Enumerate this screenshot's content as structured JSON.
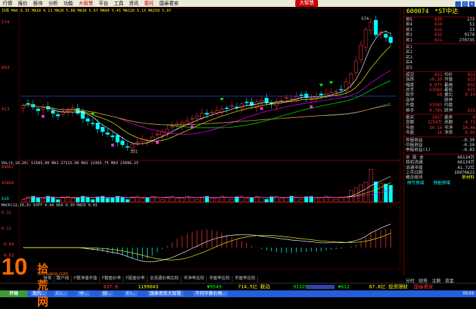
{
  "menu": {
    "items": [
      "行情",
      "报价",
      "板块",
      "分析",
      "功能",
      "大智慧",
      "平台",
      "工具",
      "资讯",
      "委托",
      "国泰君安"
    ],
    "brand": "大智慧"
  },
  "window_buttons": [
    "_",
    "□",
    "x"
  ],
  "main_chart": {
    "price_labels": [
      "574",
      "493",
      "413"
    ],
    "peak_label": "574",
    "low_label": "331",
    "ma_line": "日线 MA5 6.35 MA10 6.11 MA20 5.88 MA30 5.67 MA60 5.41 MA120 5.15 MA250 5.07"
  },
  "volume_panel": {
    "header": "VOL(5,10,20)  51583.00  MA1 27115.00  MA2 22465.75  MA3 23996.25",
    "labels": [
      "84067",
      "42484",
      "X10"
    ]
  },
  "macd_panel": {
    "header": "MACD(12,26,9)  DIFF 0.48  DEA 0.39  MACD 0.03",
    "labels": [
      "0.31",
      "0.11",
      "-0.09",
      "-0.02"
    ]
  },
  "chart_data": {
    "type": "candlestick",
    "title": "600074 *ST中达",
    "y_price_ticks": [
      574,
      493,
      413
    ],
    "y_volume_ticks": [
      84067,
      42484
    ],
    "y_macd_ticks": [
      0.31,
      0.11,
      -0.09
    ],
    "approx_close": [
      4.15,
      4.18,
      4.12,
      4.05,
      4.1,
      4.08,
      4.0,
      3.95,
      4.02,
      4.06,
      4.1,
      4.0,
      3.9,
      3.85,
      3.8,
      3.7,
      3.65,
      3.6,
      3.55,
      3.45,
      3.4,
      3.35,
      3.4,
      3.45,
      3.5,
      3.48,
      3.55,
      3.6,
      3.65,
      3.7,
      3.75,
      3.8,
      3.82,
      3.85,
      3.9,
      3.95,
      4.0,
      3.98,
      4.02,
      4.05,
      4.08,
      4.1,
      4.15,
      4.12,
      4.18,
      4.2,
      4.15,
      4.22,
      4.25,
      4.2,
      4.18,
      4.22,
      4.25,
      4.3,
      4.28,
      4.32,
      4.35,
      4.3,
      4.28,
      4.33,
      4.35,
      4.38,
      4.4,
      4.42,
      4.45,
      4.6,
      4.75,
      5.0,
      5.3,
      5.6,
      5.74,
      5.5,
      5.55,
      5.45,
      5.35
    ]
  },
  "right_panel": {
    "code": "600074",
    "name": "*ST中达",
    "orderbook": {
      "sell": [
        {
          "label": "卖",
          "lvl": "5",
          "price": "635",
          "vol": "173"
        },
        {
          "label": "卖",
          "lvl": "4",
          "price": "634",
          "vol": "51"
        },
        {
          "label": "卖",
          "lvl": "3",
          "price": "633",
          "vol": "23"
        },
        {
          "label": "卖",
          "lvl": "2",
          "price": "632",
          "vol": "9178"
        },
        {
          "label": "卖",
          "lvl": "1",
          "price": "631",
          "vol": "270735"
        }
      ],
      "buy": [
        {
          "label": "买",
          "lvl": "1",
          "price": "",
          "vol": ""
        },
        {
          "label": "买",
          "lvl": "2",
          "price": "",
          "vol": ""
        },
        {
          "label": "买",
          "lvl": "3",
          "price": "",
          "vol": ""
        },
        {
          "label": "买",
          "lvl": "4",
          "price": "",
          "vol": ""
        },
        {
          "label": "买",
          "lvl": "5",
          "price": "",
          "vol": ""
        }
      ]
    },
    "stats": [
      {
        "a": "成交",
        "b": "631",
        "c": "均价",
        "d": "631"
      },
      {
        "a": "涨跌",
        "b": "↑0.30",
        "c": "开盘",
        "d": "632"
      },
      {
        "a": "幅度",
        "b": "4.97%",
        "c": "最高",
        "d": "632"
      },
      {
        "a": "总手",
        "b": "51583",
        "c": "最低",
        "d": "631"
      },
      {
        "a": "现手",
        "b": "58",
        "c": "量比",
        "d": "0.19"
      },
      {
        "a": "涨停",
        "b": "",
        "c": "跌停",
        "d": ""
      },
      {
        "a": "外盘",
        "b": "51583",
        "c": "内盘",
        "d": ""
      },
      {
        "a": "换手",
        "b": "0.78%",
        "c": "跌停",
        "d": "631"
      }
    ],
    "finance": [
      {
        "k": "委买",
        "v": "1437",
        "k2": "委卖",
        "v2": "0"
      },
      {
        "k": "金额",
        "v": "3254万",
        "k2": "总额",
        "v2": "-4.71"
      },
      {
        "k": "市盈",
        "v": "20.16",
        "k2": "市净",
        "v2": "10.46"
      },
      {
        "k": "市盈",
        "v": "-16",
        "k2": "净资",
        "v2": "0.02"
      }
    ],
    "eps": [
      {
        "k": "年报收益",
        "v": "-0.39"
      },
      {
        "k": "中报收益",
        "v": "-0.10"
      },
      {
        "k": "季报收益(1)",
        "v": "-0.03"
      }
    ],
    "capital": [
      {
        "k": "总 股 本",
        "v": "66124万"
      },
      {
        "k": "目前流通",
        "v": "66124万"
      },
      {
        "k": "流通市值",
        "v": "41.72亿"
      },
      {
        "k": "上市日期",
        "v": "19970623"
      },
      {
        "k": "概念板块",
        "v": "新材料"
      }
    ],
    "links": [
      "预亏预减",
      "预盈预增"
    ],
    "tabs": [
      "分时",
      "财务",
      "主联",
      "资金"
    ]
  },
  "bottom_tabs": [
    "财务",
    "散户线",
    "F散净值市值",
    "F散盈价率",
    "F股盈价率",
    "全流通价格比较",
    "市净率比较",
    "市盈率比较",
    "市盈率比较"
  ],
  "ticker": {
    "items": [
      {
        "t": "837.8",
        "c": "#ff3333"
      },
      {
        "t": "1199043",
        "c": "#ffff00"
      },
      {
        "t": "▼9549",
        "c": "#00ff00"
      },
      {
        "t": "714.5亿 联动",
        "c": "#ffff00"
      },
      {
        "t": "91328",
        "c": "#00ff00"
      },
      {
        "t": "▼612",
        "c": "#00ff00"
      },
      {
        "t": "87.8亿 投资理财",
        "c": "#ffff00"
      },
      {
        "t": "国泰君安",
        "c": "#ff3333"
      }
    ]
  },
  "taskbar": {
    "start": "开始",
    "tasks": [
      "我的...",
      "C:\\...",
      "中...",
      "财...",
      "E:\\...",
      "国泰君安大智慧",
      "不同平衡价格..."
    ],
    "clock": "09:59"
  },
  "watermark": {
    "big": "10",
    "mid": "拾荒网",
    "sub": "Shihuang.com"
  },
  "colors": {
    "up": "#ff3333",
    "down": "#00ffff",
    "bg": "#000000",
    "grid": "#7a0000"
  }
}
